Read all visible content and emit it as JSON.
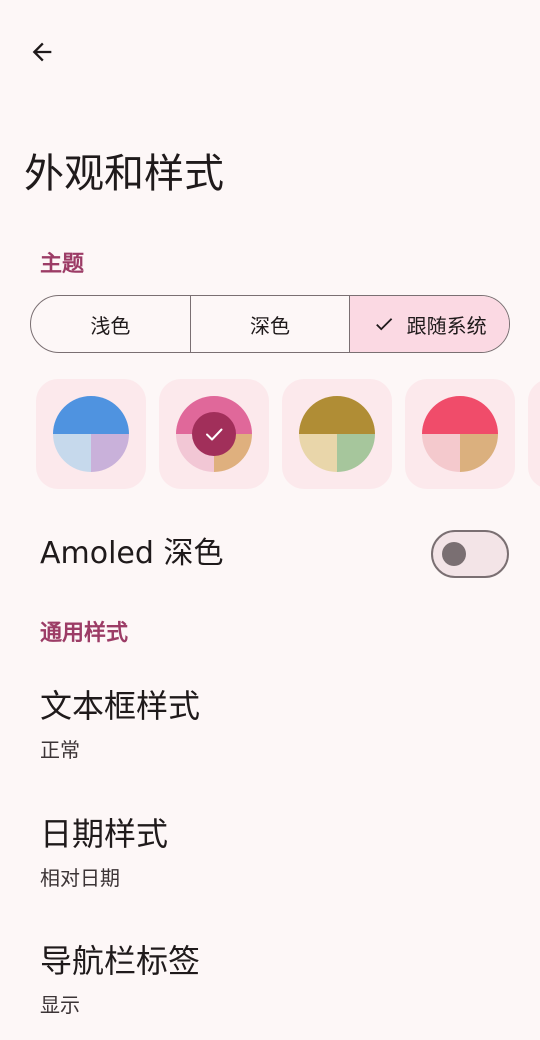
{
  "header": {
    "back_icon": "arrow-left-icon",
    "title": "外观和样式"
  },
  "theme": {
    "section_label": "主题",
    "modes": [
      "浅色",
      "深色",
      "跟随系统"
    ],
    "selected_mode": "跟随系统",
    "check_icon": "check-icon",
    "swatches": [
      {
        "name": "blue",
        "top": "#4f93e0",
        "bottom_left": "#c6d9ec",
        "bottom_right": "#c9b1da",
        "selected": false
      },
      {
        "name": "pink",
        "top": "#e0689a",
        "bottom_left": "#f2c7d5",
        "bottom_right": "#dfb07e",
        "selected": true
      },
      {
        "name": "olive",
        "top": "#b08d35",
        "bottom_left": "#e9d6aa",
        "bottom_right": "#a6c69c",
        "selected": false
      },
      {
        "name": "red",
        "top": "#f04c6a",
        "bottom_left": "#f4c9cd",
        "bottom_right": "#dbb07e",
        "selected": false
      }
    ],
    "selected_badge_color": "#a12f5a"
  },
  "amoled": {
    "label": "Amoled 深色",
    "enabled": false
  },
  "general": {
    "section_label": "通用样式",
    "items": [
      {
        "title": "文本框样式",
        "value": "正常"
      },
      {
        "title": "日期样式",
        "value": "相对日期"
      },
      {
        "title": "导航栏标签",
        "value": "显示"
      }
    ]
  },
  "colors": {
    "accent": "#9c3c66",
    "background": "#fdf7f7",
    "segment_selected": "#fbd9e3",
    "swatch_card": "#fce9ec"
  }
}
